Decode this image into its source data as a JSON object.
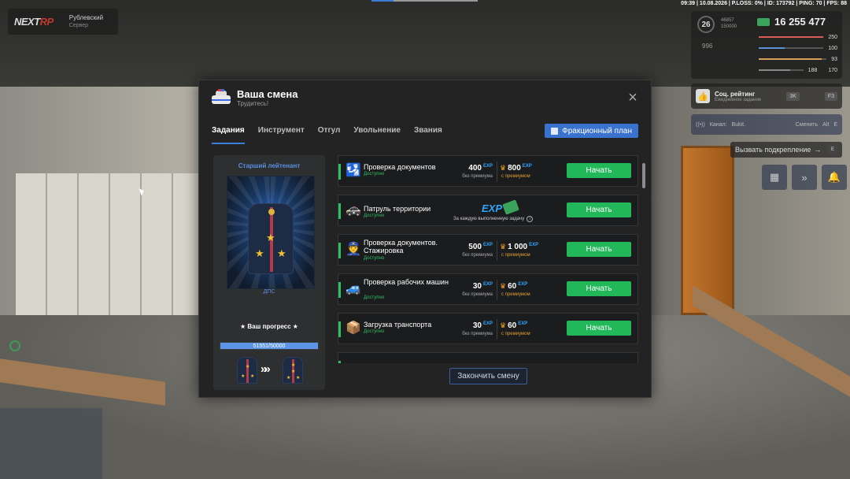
{
  "hud": {
    "logo_a": "NEXT",
    "logo_b": "RP",
    "server_name": "Рублевский",
    "server_sub": "Сервер",
    "status_line": "09:39 | 10.08.2026 | P.LOSS: 0% | ID: 173792 | PING: 70 | FPS: 88",
    "level": "26",
    "level_xp_a": "46857",
    "level_xp_b": "150000",
    "money": "16 255 477",
    "wanted": "996",
    "bars": [
      {
        "value": "250",
        "icon": "heart-icon",
        "color": "#d85b5b"
      },
      {
        "value": "100",
        "icon": "mic-icon",
        "color": "#5b8fd8"
      },
      {
        "value": "93",
        "icon": "food-icon",
        "color": "#d8a05b"
      },
      {
        "value": "170",
        "icon": "shield-icon",
        "color": "#888888"
      }
    ],
    "bars_extra": "188",
    "social_title": "Соц. рейтинг",
    "social_sub": "Ежедневное задание",
    "social_value": "3K",
    "social_key": "F3",
    "channel_label": "Канал:",
    "channel_value": "Bukit.",
    "channel_switch": "Сменить",
    "channel_key_a": "Alt",
    "channel_key_b": "E",
    "backup_label": "Вызвать подкрепление",
    "backup_key": "E"
  },
  "modal": {
    "title": "Ваша смена",
    "subtitle": "Трудитесь!",
    "tabs": [
      "Задания",
      "Инструмент",
      "Отгул",
      "Увольнение",
      "Звания"
    ],
    "faction_button": "Фракционный план",
    "rank_title": "Старший лейтенант",
    "rank_caption": "ДПС",
    "progress_label": "★ Ваш прогресс ★",
    "progress_text": "51551/50000",
    "progress_value": 1.0,
    "finish_button": "Закончить смену"
  },
  "tasks": [
    {
      "icon": "passport-icon",
      "name": "Проверка документов",
      "status": "Доступно",
      "exp_no_premium": "400",
      "exp_premium": "800",
      "no_premium_label": "без премиума",
      "premium_label": "с премиумом",
      "button": "Начать"
    },
    {
      "icon": "patrol-car-icon",
      "name": "Патруль территории",
      "status": "Доступно",
      "reward_note": "За каждую выполненную задачу",
      "button": "Начать"
    },
    {
      "icon": "people-icon",
      "name": "Проверка документов. Стажировка",
      "status": "Доступно",
      "exp_no_premium": "500",
      "exp_premium": "1 000",
      "no_premium_label": "без премиума",
      "premium_label": "с премиумом",
      "button": "Начать"
    },
    {
      "icon": "work-car-icon",
      "name": "Проверка рабочих машин",
      "status": "Доступно",
      "exp_no_premium": "30",
      "exp_premium": "60",
      "no_premium_label": "без премиума",
      "premium_label": "с премиумом",
      "button": "Начать"
    },
    {
      "icon": "truck-load-icon",
      "name": "Загрузка транспорта",
      "status": "Доступно",
      "exp_no_premium": "30",
      "exp_premium": "60",
      "no_premium_label": "без премиума",
      "premium_label": "с премиумом",
      "button": "Начать"
    }
  ],
  "exp_badge": "EXP"
}
